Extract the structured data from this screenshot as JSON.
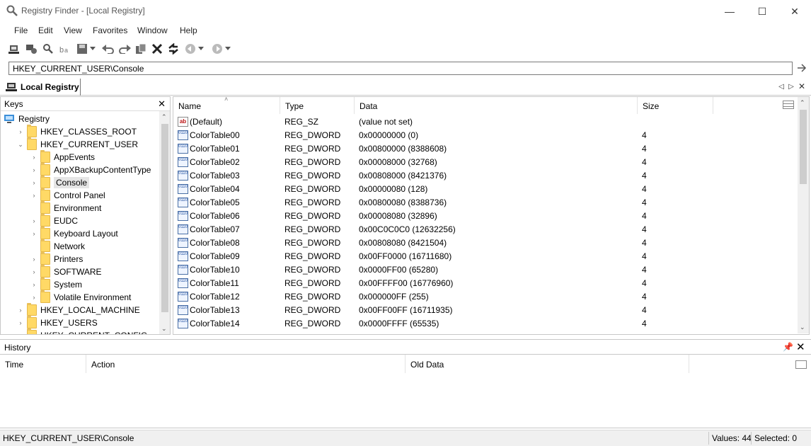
{
  "window": {
    "title": "Registry Finder - [Local Registry]",
    "controls": [
      "—",
      "☐",
      "✕"
    ]
  },
  "menu": [
    "File",
    "Edit",
    "View",
    "Favorites",
    "Window",
    "Help"
  ],
  "address": {
    "value": "HKEY_CURRENT_USER\\Console"
  },
  "document_tab": {
    "label": "Local Registry"
  },
  "keys_pane": {
    "header": "Keys",
    "tree": [
      {
        "label": "Registry",
        "level": 0,
        "expander": "",
        "type": "computer"
      },
      {
        "label": "HKEY_CLASSES_ROOT",
        "level": 1,
        "expander": "›"
      },
      {
        "label": "HKEY_CURRENT_USER",
        "level": 1,
        "expander": "⌄"
      },
      {
        "label": "AppEvents",
        "level": 2,
        "expander": "›"
      },
      {
        "label": "AppXBackupContentType",
        "level": 2,
        "expander": "›"
      },
      {
        "label": "Console",
        "level": 2,
        "expander": "›",
        "selected": true
      },
      {
        "label": "Control Panel",
        "level": 2,
        "expander": "›"
      },
      {
        "label": "Environment",
        "level": 2,
        "expander": ""
      },
      {
        "label": "EUDC",
        "level": 2,
        "expander": "›"
      },
      {
        "label": "Keyboard Layout",
        "level": 2,
        "expander": "›"
      },
      {
        "label": "Network",
        "level": 2,
        "expander": ""
      },
      {
        "label": "Printers",
        "level": 2,
        "expander": "›"
      },
      {
        "label": "SOFTWARE",
        "level": 2,
        "expander": "›"
      },
      {
        "label": "System",
        "level": 2,
        "expander": "›"
      },
      {
        "label": "Volatile Environment",
        "level": 2,
        "expander": "›"
      },
      {
        "label": "HKEY_LOCAL_MACHINE",
        "level": 1,
        "expander": "›"
      },
      {
        "label": "HKEY_USERS",
        "level": 1,
        "expander": "›"
      },
      {
        "label": "HKEY_CURRENT_CONFIG",
        "level": 1,
        "expander": "›"
      }
    ]
  },
  "values_pane": {
    "columns": [
      "Name",
      "Type",
      "Data",
      "Size"
    ],
    "rows": [
      {
        "name": "(Default)",
        "type": "REG_SZ",
        "data": "(value not set)",
        "size": "",
        "icon": "string-value-icon"
      },
      {
        "name": "ColorTable00",
        "type": "REG_DWORD",
        "data": "0x00000000 (0)",
        "size": "4",
        "icon": "dword-value-icon"
      },
      {
        "name": "ColorTable01",
        "type": "REG_DWORD",
        "data": "0x00800000 (8388608)",
        "size": "4",
        "icon": "dword-value-icon"
      },
      {
        "name": "ColorTable02",
        "type": "REG_DWORD",
        "data": "0x00008000 (32768)",
        "size": "4",
        "icon": "dword-value-icon"
      },
      {
        "name": "ColorTable03",
        "type": "REG_DWORD",
        "data": "0x00808000 (8421376)",
        "size": "4",
        "icon": "dword-value-icon"
      },
      {
        "name": "ColorTable04",
        "type": "REG_DWORD",
        "data": "0x00000080 (128)",
        "size": "4",
        "icon": "dword-value-icon"
      },
      {
        "name": "ColorTable05",
        "type": "REG_DWORD",
        "data": "0x00800080 (8388736)",
        "size": "4",
        "icon": "dword-value-icon"
      },
      {
        "name": "ColorTable06",
        "type": "REG_DWORD",
        "data": "0x00008080 (32896)",
        "size": "4",
        "icon": "dword-value-icon"
      },
      {
        "name": "ColorTable07",
        "type": "REG_DWORD",
        "data": "0x00C0C0C0 (12632256)",
        "size": "4",
        "icon": "dword-value-icon"
      },
      {
        "name": "ColorTable08",
        "type": "REG_DWORD",
        "data": "0x00808080 (8421504)",
        "size": "4",
        "icon": "dword-value-icon"
      },
      {
        "name": "ColorTable09",
        "type": "REG_DWORD",
        "data": "0x00FF0000 (16711680)",
        "size": "4",
        "icon": "dword-value-icon"
      },
      {
        "name": "ColorTable10",
        "type": "REG_DWORD",
        "data": "0x0000FF00 (65280)",
        "size": "4",
        "icon": "dword-value-icon"
      },
      {
        "name": "ColorTable11",
        "type": "REG_DWORD",
        "data": "0x00FFFF00 (16776960)",
        "size": "4",
        "icon": "dword-value-icon"
      },
      {
        "name": "ColorTable12",
        "type": "REG_DWORD",
        "data": "0x000000FF (255)",
        "size": "4",
        "icon": "dword-value-icon"
      },
      {
        "name": "ColorTable13",
        "type": "REG_DWORD",
        "data": "0x00FF00FF (16711935)",
        "size": "4",
        "icon": "dword-value-icon"
      },
      {
        "name": "ColorTable14",
        "type": "REG_DWORD",
        "data": "0x0000FFFF (65535)",
        "size": "4",
        "icon": "dword-value-icon"
      }
    ]
  },
  "history": {
    "header": "History",
    "columns": [
      "Time",
      "Action",
      "Old Data"
    ]
  },
  "status": {
    "path": "HKEY_CURRENT_USER\\Console",
    "values": "Values: 44",
    "selected": "Selected: 0"
  },
  "colors": {
    "folder": "#ffd966",
    "selection": "#e5e5e5",
    "dword_icon": "#1d4e9e"
  }
}
